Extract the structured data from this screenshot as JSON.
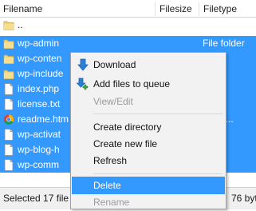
{
  "columns": {
    "filename": "Filename",
    "filesize": "Filesize",
    "filetype": "Filetype"
  },
  "rows": [
    {
      "name": "..",
      "type": "",
      "icon": "folder-icon",
      "selected": false
    },
    {
      "name": "wp-admin",
      "type": "File folder",
      "icon": "folder-icon",
      "selected": true
    },
    {
      "name": "wp-conten",
      "type": "older",
      "icon": "folder-icon",
      "selected": true
    },
    {
      "name": "wp-include",
      "type": "older",
      "icon": "folder-icon",
      "selected": true
    },
    {
      "name": "index.php",
      "type": "ile",
      "icon": "file-icon",
      "selected": true
    },
    {
      "name": "license.txt",
      "type": "ile",
      "icon": "file-icon",
      "selected": true
    },
    {
      "name": "readme.htm",
      "type": "me H...",
      "icon": "chrome-icon",
      "selected": true
    },
    {
      "name": "wp-activat",
      "type": "ile",
      "icon": "file-icon",
      "selected": true
    },
    {
      "name": "wp-blog-h",
      "type": "ile",
      "icon": "file-icon",
      "selected": true
    },
    {
      "name": "wp-comm",
      "type": "ile",
      "icon": "file-icon",
      "selected": true
    }
  ],
  "status": {
    "left": "Selected 17 file",
    "right": "76 byt"
  },
  "context_menu": {
    "download": "Download",
    "add_to_queue": "Add files to queue",
    "view_edit": "View/Edit",
    "create_directory": "Create directory",
    "create_file": "Create new file",
    "refresh": "Refresh",
    "delete": "Delete",
    "rename": "Rename"
  },
  "colors": {
    "selection": "#3399ff",
    "menu_background": "#f2f2f2",
    "disabled_text": "#9a9a9a"
  }
}
